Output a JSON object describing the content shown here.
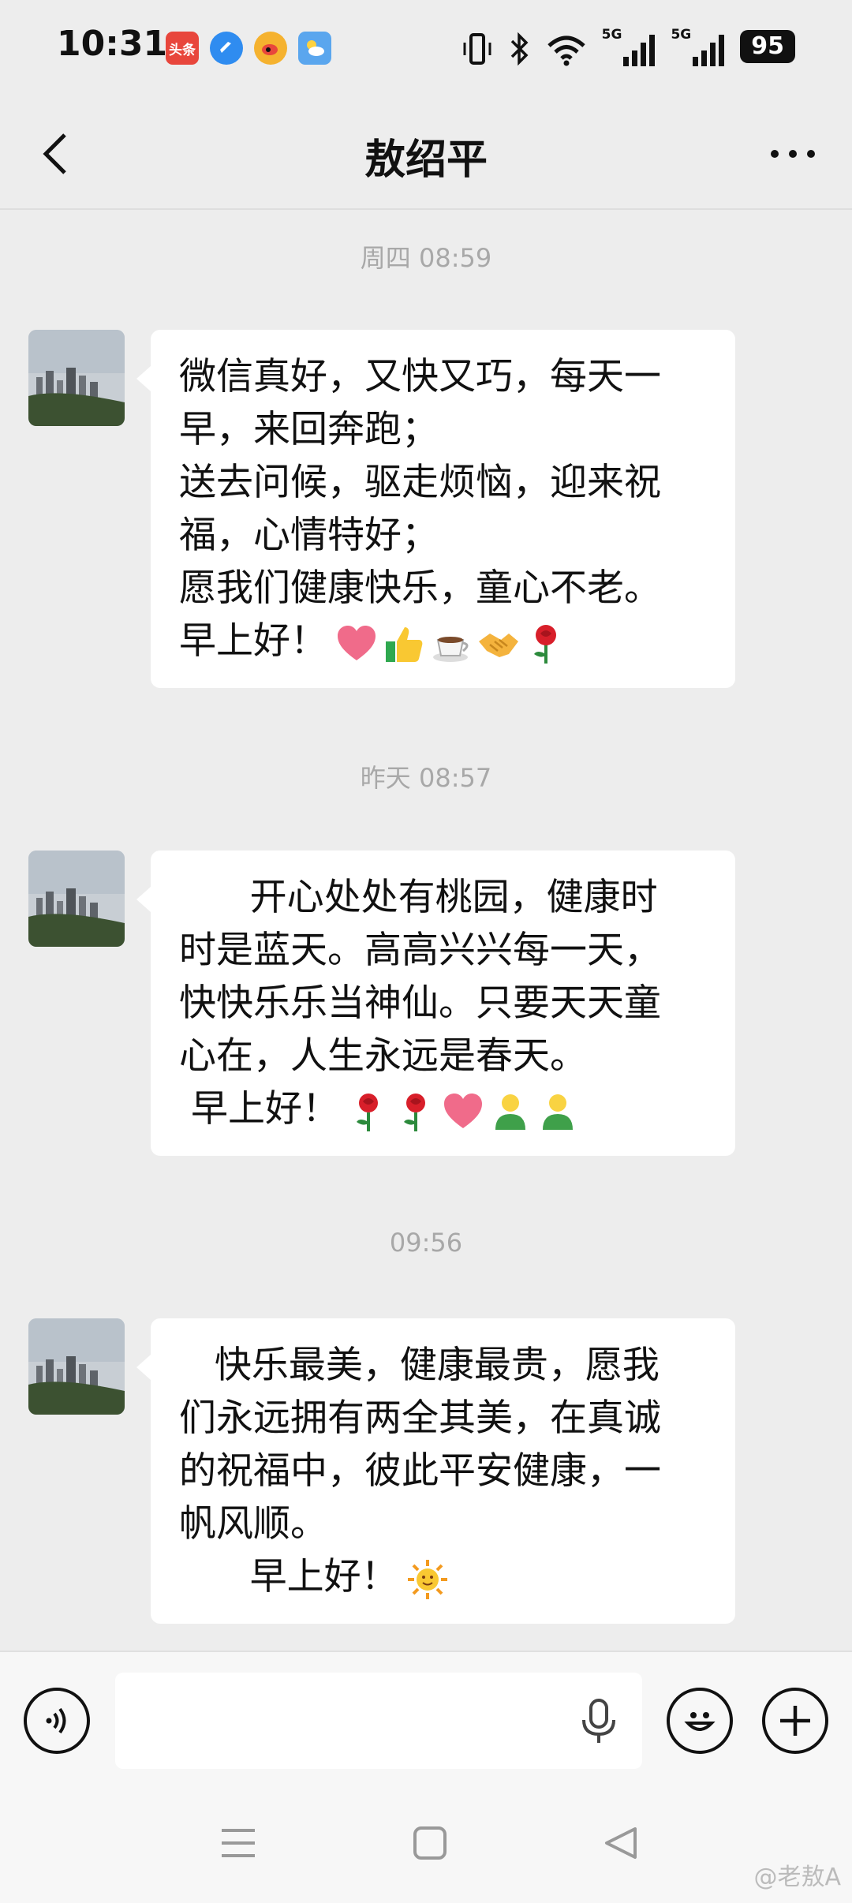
{
  "status_bar": {
    "time": "10:31",
    "notifications": [
      {
        "icon": "toutiao-icon",
        "text": "头条",
        "color": "#e8463c"
      },
      {
        "icon": "app-blue-icon",
        "color": "#2f8cf0"
      },
      {
        "icon": "weibo-icon",
        "color": "#f5b22f"
      },
      {
        "icon": "weather-icon",
        "color": "#5aa6ee"
      }
    ],
    "signal_label_1": "5G",
    "signal_label_2": "5G",
    "battery": "95"
  },
  "header": {
    "title": "敖绍平",
    "back_icon": "chevron-left-icon",
    "more_icon": "more-dots-icon"
  },
  "messages": [
    {
      "timestamp": "周四 08:59",
      "lines": [
        "微信真好，又快又巧，每天一",
        "早，来回奔跑；",
        "送去问候，驱走烦恼，迎来祝",
        "福，心情特好；",
        "愿我们健康快乐，童心不老。"
      ],
      "closing": "早上好！",
      "emojis": [
        "heart",
        "thumbs-up",
        "coffee",
        "handshake",
        "rose"
      ]
    },
    {
      "timestamp": "昨天 08:57",
      "lines": [
        "      开心处处有桃园，健康时",
        "时是蓝天。高高兴兴每一天，",
        "快快乐乐当神仙。只要天天童",
        "心在，人生永远是春天。"
      ],
      "closing": " 早上好！",
      "emojis": [
        "rose",
        "rose",
        "heart",
        "person",
        "person"
      ]
    },
    {
      "timestamp": "09:56",
      "lines": [
        "   快乐最美，健康最贵，愿我",
        "们永远拥有两全其美，在真诚",
        "的祝福中，彼此平安健康，一",
        "帆风顺。"
      ],
      "closing": "      早上好！",
      "emojis": [
        "sun"
      ]
    }
  ],
  "input_bar": {
    "voice_icon": "voice-icon",
    "mic_icon": "microphone-icon",
    "emoji_icon": "smiley-icon",
    "plus_icon": "plus-icon",
    "text_value": ""
  },
  "nav_bar": {
    "menu_icon": "menu-icon",
    "home_icon": "home-square-icon",
    "back_icon": "back-triangle-icon"
  },
  "watermark": "@老敖A",
  "colors": {
    "background": "#ededed",
    "bubble": "#ffffff",
    "timestamp": "#a8a8a8",
    "accent_heart": "#f06b8a",
    "accent_rose": "#d81f2a"
  }
}
